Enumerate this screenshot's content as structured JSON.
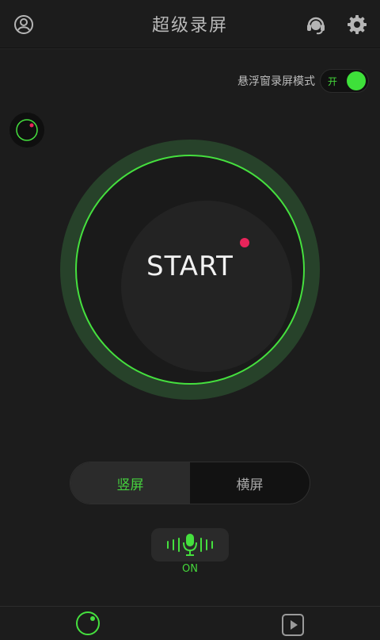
{
  "header": {
    "title": "超级录屏",
    "left_icon": "profile-icon",
    "right_icons": [
      "support-headset-icon",
      "settings-gear-icon"
    ]
  },
  "floating_mode": {
    "label": "悬浮窗录屏模式",
    "switch_text": "开",
    "enabled": true
  },
  "record": {
    "start_label": "START"
  },
  "orientation": {
    "options": [
      {
        "label": "竖屏",
        "selected": true
      },
      {
        "label": "横屏",
        "selected": false
      }
    ]
  },
  "mic": {
    "state_label": "ON"
  },
  "bottom_nav": {
    "items": [
      "record-dial-icon",
      "video-play-icon"
    ]
  },
  "colors": {
    "accent": "#45e03e",
    "background": "#1c1c1c",
    "record_dot": "#e8245a"
  }
}
